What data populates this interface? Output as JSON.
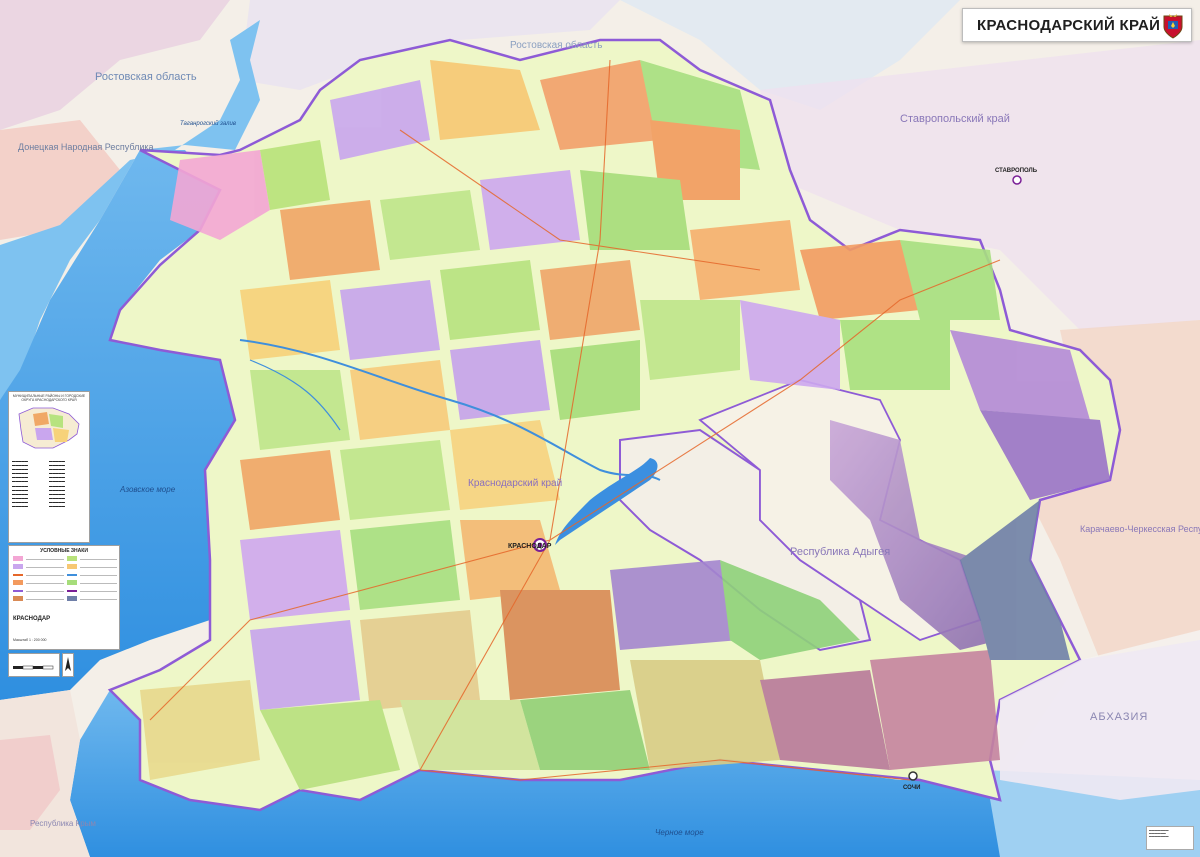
{
  "header": {
    "title": "КРАСНОДАРСКИЙ КРАЙ",
    "emblem_icon": "coat-of-arms-icon"
  },
  "neighbors": {
    "rostov_oblast_west": "Ростовская область",
    "rostov_oblast_north": "Ростовская область",
    "donetsk_republic": "Донецкая Народная Республика",
    "stavropol_krai": "Ставропольский край",
    "adygea": "Республика Адыгея",
    "karachay_cherkessia": "Карачаево-Черкесская Республика",
    "abkhazia": "АБХАЗИЯ",
    "crimea": "Республика Крым"
  },
  "water": {
    "azov_sea": "Азовское море",
    "black_sea": "Черное море",
    "taganrog_bay": "Таганрогский залив"
  },
  "cities": {
    "krasnodar": "КРАСНОДАР",
    "sochi": "СОЧИ",
    "stavropol": "СТАВРОПОЛЬ",
    "region_label": "Краснодарский край"
  },
  "legend": {
    "heading": "МУНИЦИПАЛЬНЫЕ РАЙОНЫ И ГОРОДСКИЕ ОКРУГА КРАСНОДАРСКОГО КРАЯ",
    "signs_title": "УСЛОВНЫЕ ЗНАКИ",
    "city_sample": "КРАСНОДАР",
    "scale_text": "Масштаб 1 : 200 000"
  },
  "colors": {
    "sea": "#3f9be6",
    "shallow": "#8ccdf5",
    "region_border": "#8e5bd6",
    "neighbor_land": "#f6f0ea",
    "title_text": "#1f1f1f"
  }
}
